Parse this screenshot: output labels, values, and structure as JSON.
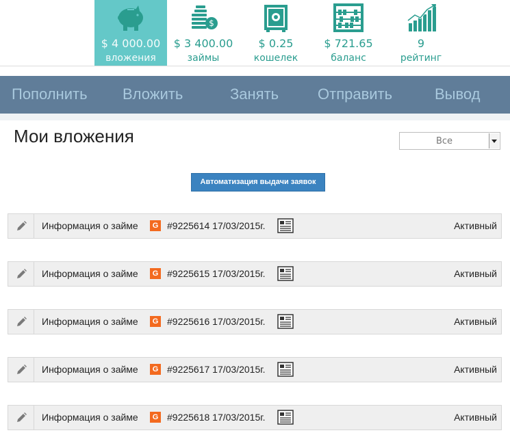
{
  "stats": [
    {
      "icon": "piggy-bank-icon",
      "amount": "$ 4 000.00",
      "label": "вложения",
      "active": true
    },
    {
      "icon": "coins-icon",
      "amount": "$ 3 400.00",
      "label": "займы",
      "active": false
    },
    {
      "icon": "safe-icon",
      "amount": "$ 0.25",
      "label": "кошелек",
      "active": false
    },
    {
      "icon": "abacus-icon",
      "amount": "$ 721.65",
      "label": "баланс",
      "active": false
    },
    {
      "icon": "rating-chart-icon",
      "amount": "9",
      "label": "рейтинг",
      "active": false
    }
  ],
  "actions": [
    "Пополнить",
    "Вложить",
    "Занять",
    "Отправить",
    "Вывод"
  ],
  "page": {
    "title": "Мои вложения",
    "filter_value": "Все",
    "auto_button": "Автоматизация выдачи заявок"
  },
  "loans": [
    {
      "info": "Информация о займе",
      "badge": "G",
      "number": "#9225614 17/03/2015г.",
      "status": "Активный"
    },
    {
      "info": "Информация о займе",
      "badge": "G",
      "number": "#9225615 17/03/2015г.",
      "status": "Активный"
    },
    {
      "info": "Информация о займе",
      "badge": "G",
      "number": "#9225616 17/03/2015г.",
      "status": "Активный"
    },
    {
      "info": "Информация о займе",
      "badge": "G",
      "number": "#9225617 17/03/2015г.",
      "status": "Активный"
    },
    {
      "info": "Информация о займе",
      "badge": "G",
      "number": "#9225618 17/03/2015г.",
      "status": "Активный"
    }
  ],
  "colors": {
    "accent": "#64c8c8",
    "icon": "#2a9d8f",
    "action_bar": "#607d99",
    "action_text": "#a9c9de",
    "button": "#3b83c0",
    "badge": "#f36a1f"
  }
}
